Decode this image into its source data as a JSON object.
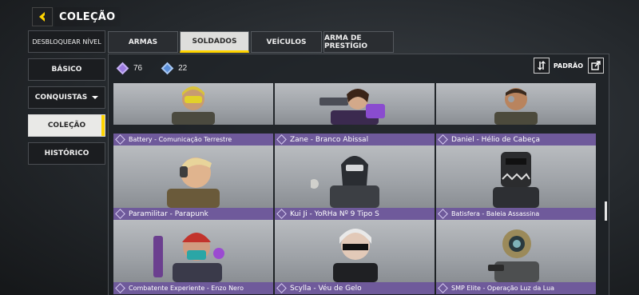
{
  "header": {
    "title": "COLEÇÃO"
  },
  "sidebar": {
    "items": [
      {
        "label": "DESBLOQUEAR NÍVEL"
      },
      {
        "label": "BÁSICO"
      },
      {
        "label": "CONQUISTAS"
      },
      {
        "label": "COLEÇÃO"
      },
      {
        "label": "HISTÓRICO"
      }
    ]
  },
  "tabs": [
    {
      "label": "ARMAS"
    },
    {
      "label": "SOLDADOS"
    },
    {
      "label": "VEÍCULOS"
    },
    {
      "label": "ARMA DE PRESTÍGIO"
    }
  ],
  "stats": {
    "purple_count": "76",
    "blue_count": "22"
  },
  "sort": {
    "label": "PADRÃO"
  },
  "cards": [
    {
      "name": "Battery - Comunicação Terrestre"
    },
    {
      "name": "Zane - Branco Abissal"
    },
    {
      "name": "Daniel - Hélio de Cabeça"
    },
    {
      "name": "Paramilitar - Parapunk"
    },
    {
      "name": "Kui Ji - YoRHa Nº 9 Tipo S"
    },
    {
      "name": "Batisfera - Baleia Assassina"
    },
    {
      "name": "Combatente Experiente - Enzo Nero"
    },
    {
      "name": "Scylla - Véu de Gelo"
    },
    {
      "name": "SMP Elite - Operação Luz da Lua"
    }
  ],
  "colors": {
    "accent": "#ffd400",
    "rarity_bar": "#6f5a9b"
  },
  "icons": [
    "back-arrow-icon",
    "purple-diamond-icon",
    "blue-diamond-icon",
    "sort-icon",
    "share-icon",
    "rarity-diamond-icon"
  ]
}
